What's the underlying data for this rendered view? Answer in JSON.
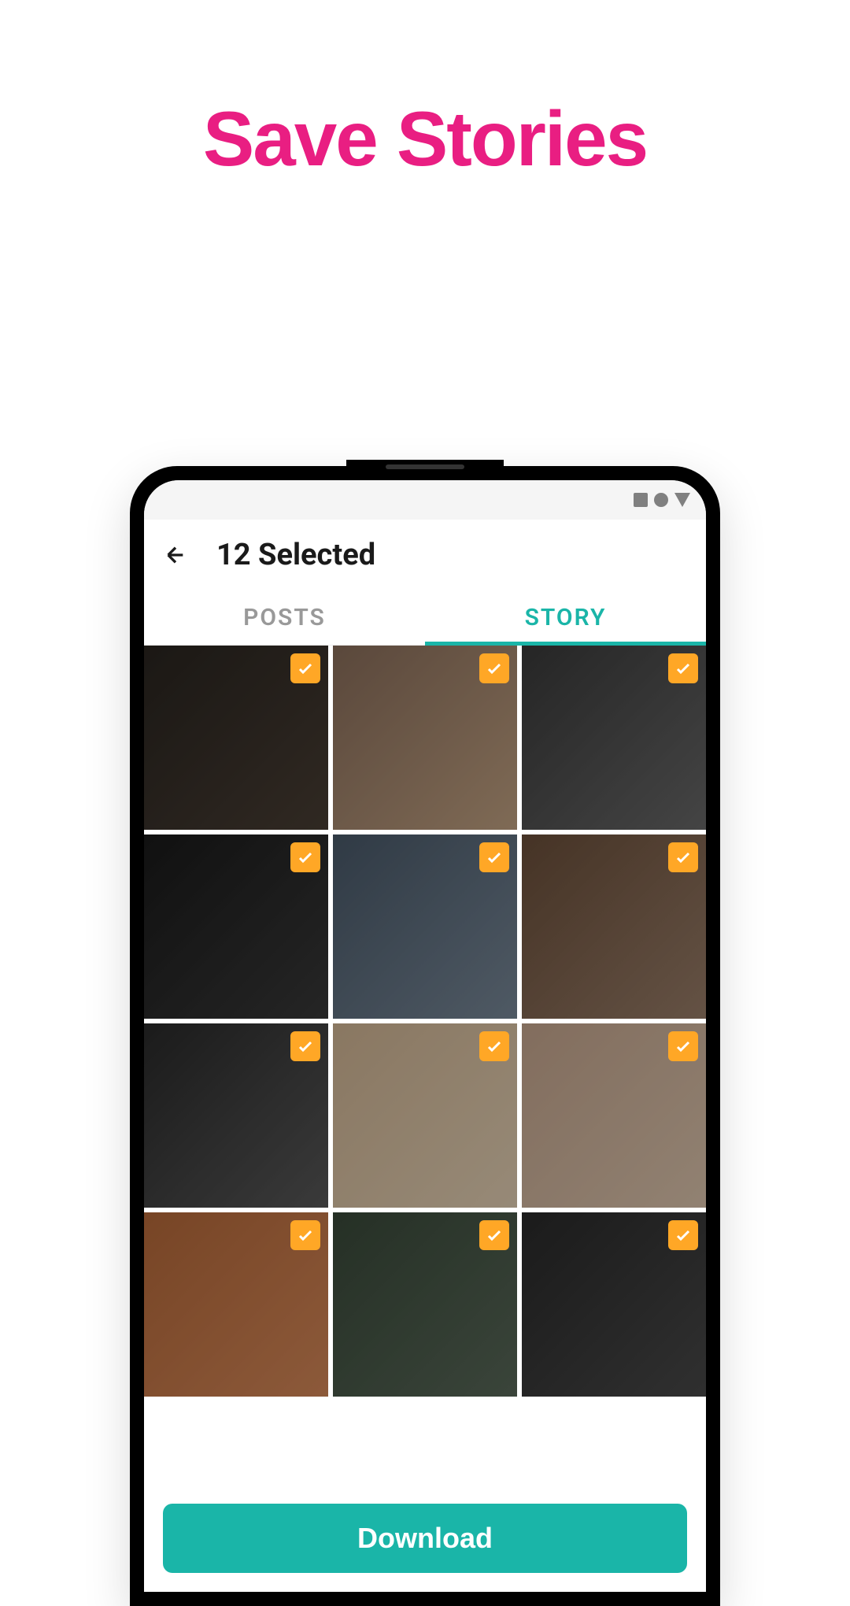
{
  "headline": "Save Stories",
  "header": {
    "title": "12 Selected"
  },
  "tabs": {
    "posts": "POSTS",
    "story": "STORY",
    "active": "story"
  },
  "grid": {
    "items": [
      {
        "selected": true
      },
      {
        "selected": true
      },
      {
        "selected": true
      },
      {
        "selected": true
      },
      {
        "selected": true
      },
      {
        "selected": true
      },
      {
        "selected": true
      },
      {
        "selected": true
      },
      {
        "selected": true
      },
      {
        "selected": true
      },
      {
        "selected": true
      },
      {
        "selected": true
      }
    ]
  },
  "actions": {
    "download": "Download"
  },
  "colors": {
    "accent": "#1ab5a8",
    "headline": "#e91e82",
    "checkbox": "#ffa726"
  }
}
